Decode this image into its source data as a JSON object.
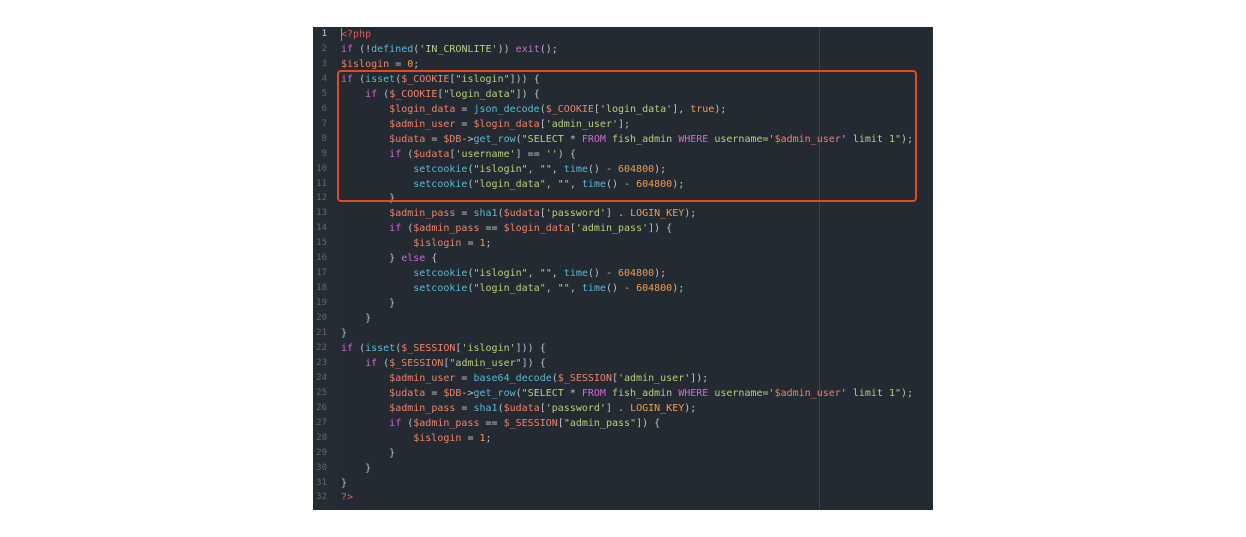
{
  "colors": {
    "keyword": "#cf6ad6",
    "variable": "#f0826a",
    "string": "#b9cf7a",
    "function": "#57b9d6",
    "number": "#ef9d4f",
    "php_tag": "#e05d5d",
    "plain": "#b8c2cc",
    "highlight_border": "#e8481f",
    "editor_bg": "#242a31"
  },
  "highlight": {
    "from_line": 4,
    "to_line": 12
  },
  "lines": [
    {
      "n": "1",
      "active": true,
      "tokens": [
        {
          "t": "tag",
          "v": "<?php"
        }
      ]
    },
    {
      "n": "2",
      "tokens": [
        {
          "t": "kw",
          "v": "if"
        },
        {
          "t": "plain",
          "v": " (!"
        },
        {
          "t": "fn",
          "v": "defined"
        },
        {
          "t": "plain",
          "v": "("
        },
        {
          "t": "str",
          "v": "'IN_CRONLITE'"
        },
        {
          "t": "plain",
          "v": ")) "
        },
        {
          "t": "kw",
          "v": "exit"
        },
        {
          "t": "plain",
          "v": "();"
        }
      ]
    },
    {
      "n": "3",
      "tokens": [
        {
          "t": "var",
          "v": "$islogin"
        },
        {
          "t": "plain",
          "v": " = "
        },
        {
          "t": "num",
          "v": "0"
        },
        {
          "t": "plain",
          "v": ";"
        }
      ]
    },
    {
      "n": "4",
      "tokens": [
        {
          "t": "kw",
          "v": "if"
        },
        {
          "t": "plain",
          "v": " ("
        },
        {
          "t": "fn",
          "v": "isset"
        },
        {
          "t": "plain",
          "v": "("
        },
        {
          "t": "var",
          "v": "$_COOKIE"
        },
        {
          "t": "plain",
          "v": "["
        },
        {
          "t": "str",
          "v": "\"islogin\""
        },
        {
          "t": "plain",
          "v": "])) {"
        }
      ]
    },
    {
      "n": "5",
      "tokens": [
        {
          "t": "plain",
          "v": "    "
        },
        {
          "t": "kw",
          "v": "if"
        },
        {
          "t": "plain",
          "v": " ("
        },
        {
          "t": "var",
          "v": "$_COOKIE"
        },
        {
          "t": "plain",
          "v": "["
        },
        {
          "t": "str",
          "v": "\"login_data\""
        },
        {
          "t": "plain",
          "v": "]) {"
        }
      ]
    },
    {
      "n": "6",
      "tokens": [
        {
          "t": "plain",
          "v": "        "
        },
        {
          "t": "var",
          "v": "$login_data"
        },
        {
          "t": "plain",
          "v": " = "
        },
        {
          "t": "fn",
          "v": "json_decode"
        },
        {
          "t": "plain",
          "v": "("
        },
        {
          "t": "var",
          "v": "$_COOKIE"
        },
        {
          "t": "plain",
          "v": "["
        },
        {
          "t": "str",
          "v": "'login_data'"
        },
        {
          "t": "plain",
          "v": "], "
        },
        {
          "t": "num",
          "v": "true"
        },
        {
          "t": "plain",
          "v": ");"
        }
      ]
    },
    {
      "n": "7",
      "tokens": [
        {
          "t": "plain",
          "v": "        "
        },
        {
          "t": "var",
          "v": "$admin_user"
        },
        {
          "t": "plain",
          "v": " = "
        },
        {
          "t": "var",
          "v": "$login_data"
        },
        {
          "t": "plain",
          "v": "["
        },
        {
          "t": "str",
          "v": "'admin_user'"
        },
        {
          "t": "plain",
          "v": "];"
        }
      ]
    },
    {
      "n": "8",
      "tokens": [
        {
          "t": "plain",
          "v": "        "
        },
        {
          "t": "var",
          "v": "$udata"
        },
        {
          "t": "plain",
          "v": " = "
        },
        {
          "t": "var",
          "v": "$DB"
        },
        {
          "t": "plain",
          "v": "->"
        },
        {
          "t": "fn",
          "v": "get_row"
        },
        {
          "t": "plain",
          "v": "("
        },
        {
          "t": "str",
          "v": "\"SELECT "
        },
        {
          "t": "plain",
          "v": "* "
        },
        {
          "t": "kw",
          "v": "FROM"
        },
        {
          "t": "str",
          "v": " fish_admin "
        },
        {
          "t": "kw",
          "v": "WHERE"
        },
        {
          "t": "str",
          "v": " username='"
        },
        {
          "t": "var",
          "v": "$admin_user"
        },
        {
          "t": "str",
          "v": "' limit 1\""
        },
        {
          "t": "plain",
          "v": ");"
        }
      ]
    },
    {
      "n": "9",
      "tokens": [
        {
          "t": "plain",
          "v": "        "
        },
        {
          "t": "kw",
          "v": "if"
        },
        {
          "t": "plain",
          "v": " ("
        },
        {
          "t": "var",
          "v": "$udata"
        },
        {
          "t": "plain",
          "v": "["
        },
        {
          "t": "str",
          "v": "'username'"
        },
        {
          "t": "plain",
          "v": "] == "
        },
        {
          "t": "str",
          "v": "''"
        },
        {
          "t": "plain",
          "v": ") {"
        }
      ]
    },
    {
      "n": "10",
      "tokens": [
        {
          "t": "plain",
          "v": "            "
        },
        {
          "t": "fn",
          "v": "setcookie"
        },
        {
          "t": "plain",
          "v": "("
        },
        {
          "t": "str",
          "v": "\"islogin\""
        },
        {
          "t": "plain",
          "v": ", "
        },
        {
          "t": "str",
          "v": "\"\""
        },
        {
          "t": "plain",
          "v": ", "
        },
        {
          "t": "fn",
          "v": "time"
        },
        {
          "t": "plain",
          "v": "() - "
        },
        {
          "t": "num",
          "v": "604800"
        },
        {
          "t": "plain",
          "v": ");"
        }
      ]
    },
    {
      "n": "11",
      "tokens": [
        {
          "t": "plain",
          "v": "            "
        },
        {
          "t": "fn",
          "v": "setcookie"
        },
        {
          "t": "plain",
          "v": "("
        },
        {
          "t": "str",
          "v": "\"login_data\""
        },
        {
          "t": "plain",
          "v": ", "
        },
        {
          "t": "str",
          "v": "\"\""
        },
        {
          "t": "plain",
          "v": ", "
        },
        {
          "t": "fn",
          "v": "time"
        },
        {
          "t": "plain",
          "v": "() - "
        },
        {
          "t": "num",
          "v": "604800"
        },
        {
          "t": "plain",
          "v": ");"
        }
      ]
    },
    {
      "n": "12",
      "tokens": [
        {
          "t": "plain",
          "v": "        }"
        }
      ]
    },
    {
      "n": "13",
      "tokens": [
        {
          "t": "plain",
          "v": "        "
        },
        {
          "t": "var",
          "v": "$admin_pass"
        },
        {
          "t": "plain",
          "v": " = "
        },
        {
          "t": "fn",
          "v": "sha1"
        },
        {
          "t": "plain",
          "v": "("
        },
        {
          "t": "var",
          "v": "$udata"
        },
        {
          "t": "plain",
          "v": "["
        },
        {
          "t": "str",
          "v": "'password'"
        },
        {
          "t": "plain",
          "v": "] . "
        },
        {
          "t": "num",
          "v": "LOGIN_KEY"
        },
        {
          "t": "plain",
          "v": ");"
        }
      ]
    },
    {
      "n": "14",
      "tokens": [
        {
          "t": "plain",
          "v": "        "
        },
        {
          "t": "kw",
          "v": "if"
        },
        {
          "t": "plain",
          "v": " ("
        },
        {
          "t": "var",
          "v": "$admin_pass"
        },
        {
          "t": "plain",
          "v": " == "
        },
        {
          "t": "var",
          "v": "$login_data"
        },
        {
          "t": "plain",
          "v": "["
        },
        {
          "t": "str",
          "v": "'admin_pass'"
        },
        {
          "t": "plain",
          "v": "]) {"
        }
      ]
    },
    {
      "n": "15",
      "tokens": [
        {
          "t": "plain",
          "v": "            "
        },
        {
          "t": "var",
          "v": "$islogin"
        },
        {
          "t": "plain",
          "v": " = "
        },
        {
          "t": "num",
          "v": "1"
        },
        {
          "t": "plain",
          "v": ";"
        }
      ]
    },
    {
      "n": "16",
      "tokens": [
        {
          "t": "plain",
          "v": "        } "
        },
        {
          "t": "kw",
          "v": "else"
        },
        {
          "t": "plain",
          "v": " {"
        }
      ]
    },
    {
      "n": "17",
      "tokens": [
        {
          "t": "plain",
          "v": "            "
        },
        {
          "t": "fn",
          "v": "setcookie"
        },
        {
          "t": "plain",
          "v": "("
        },
        {
          "t": "str",
          "v": "\"islogin\""
        },
        {
          "t": "plain",
          "v": ", "
        },
        {
          "t": "str",
          "v": "\"\""
        },
        {
          "t": "plain",
          "v": ", "
        },
        {
          "t": "fn",
          "v": "time"
        },
        {
          "t": "plain",
          "v": "() - "
        },
        {
          "t": "num",
          "v": "604800"
        },
        {
          "t": "plain",
          "v": ");"
        }
      ]
    },
    {
      "n": "18",
      "tokens": [
        {
          "t": "plain",
          "v": "            "
        },
        {
          "t": "fn",
          "v": "setcookie"
        },
        {
          "t": "plain",
          "v": "("
        },
        {
          "t": "str",
          "v": "\"login_data\""
        },
        {
          "t": "plain",
          "v": ", "
        },
        {
          "t": "str",
          "v": "\"\""
        },
        {
          "t": "plain",
          "v": ", "
        },
        {
          "t": "fn",
          "v": "time"
        },
        {
          "t": "plain",
          "v": "() - "
        },
        {
          "t": "num",
          "v": "604800"
        },
        {
          "t": "plain",
          "v": ");"
        }
      ]
    },
    {
      "n": "19",
      "tokens": [
        {
          "t": "plain",
          "v": "        }"
        }
      ]
    },
    {
      "n": "20",
      "tokens": [
        {
          "t": "plain",
          "v": "    }"
        }
      ]
    },
    {
      "n": "21",
      "tokens": [
        {
          "t": "plain",
          "v": "}"
        }
      ]
    },
    {
      "n": "22",
      "tokens": [
        {
          "t": "kw",
          "v": "if"
        },
        {
          "t": "plain",
          "v": " ("
        },
        {
          "t": "fn",
          "v": "isset"
        },
        {
          "t": "plain",
          "v": "("
        },
        {
          "t": "var",
          "v": "$_SESSION"
        },
        {
          "t": "plain",
          "v": "["
        },
        {
          "t": "str",
          "v": "'islogin'"
        },
        {
          "t": "plain",
          "v": "])) {"
        }
      ]
    },
    {
      "n": "23",
      "tokens": [
        {
          "t": "plain",
          "v": "    "
        },
        {
          "t": "kw",
          "v": "if"
        },
        {
          "t": "plain",
          "v": " ("
        },
        {
          "t": "var",
          "v": "$_SESSION"
        },
        {
          "t": "plain",
          "v": "["
        },
        {
          "t": "str",
          "v": "\"admin_user\""
        },
        {
          "t": "plain",
          "v": "]) {"
        }
      ]
    },
    {
      "n": "24",
      "tokens": [
        {
          "t": "plain",
          "v": "        "
        },
        {
          "t": "var",
          "v": "$admin_user"
        },
        {
          "t": "plain",
          "v": " = "
        },
        {
          "t": "fn",
          "v": "base64_decode"
        },
        {
          "t": "plain",
          "v": "("
        },
        {
          "t": "var",
          "v": "$_SESSION"
        },
        {
          "t": "plain",
          "v": "["
        },
        {
          "t": "str",
          "v": "'admin_user'"
        },
        {
          "t": "plain",
          "v": "]);"
        }
      ]
    },
    {
      "n": "25",
      "tokens": [
        {
          "t": "plain",
          "v": "        "
        },
        {
          "t": "var",
          "v": "$udata"
        },
        {
          "t": "plain",
          "v": " = "
        },
        {
          "t": "var",
          "v": "$DB"
        },
        {
          "t": "plain",
          "v": "->"
        },
        {
          "t": "fn",
          "v": "get_row"
        },
        {
          "t": "plain",
          "v": "("
        },
        {
          "t": "str",
          "v": "\"SELECT "
        },
        {
          "t": "plain",
          "v": "* "
        },
        {
          "t": "kw",
          "v": "FROM"
        },
        {
          "t": "str",
          "v": " fish_admin "
        },
        {
          "t": "kw",
          "v": "WHERE"
        },
        {
          "t": "str",
          "v": " username='"
        },
        {
          "t": "var",
          "v": "$admin_user"
        },
        {
          "t": "str",
          "v": "' limit 1\""
        },
        {
          "t": "plain",
          "v": ");"
        }
      ]
    },
    {
      "n": "26",
      "tokens": [
        {
          "t": "plain",
          "v": "        "
        },
        {
          "t": "var",
          "v": "$admin_pass"
        },
        {
          "t": "plain",
          "v": " = "
        },
        {
          "t": "fn",
          "v": "sha1"
        },
        {
          "t": "plain",
          "v": "("
        },
        {
          "t": "var",
          "v": "$udata"
        },
        {
          "t": "plain",
          "v": "["
        },
        {
          "t": "str",
          "v": "'password'"
        },
        {
          "t": "plain",
          "v": "] . "
        },
        {
          "t": "num",
          "v": "LOGIN_KEY"
        },
        {
          "t": "plain",
          "v": ");"
        }
      ]
    },
    {
      "n": "27",
      "tokens": [
        {
          "t": "plain",
          "v": "        "
        },
        {
          "t": "kw",
          "v": "if"
        },
        {
          "t": "plain",
          "v": " ("
        },
        {
          "t": "var",
          "v": "$admin_pass"
        },
        {
          "t": "plain",
          "v": " == "
        },
        {
          "t": "var",
          "v": "$_SESSION"
        },
        {
          "t": "plain",
          "v": "["
        },
        {
          "t": "str",
          "v": "\"admin_pass\""
        },
        {
          "t": "plain",
          "v": "]) {"
        }
      ]
    },
    {
      "n": "28",
      "tokens": [
        {
          "t": "plain",
          "v": "            "
        },
        {
          "t": "var",
          "v": "$islogin"
        },
        {
          "t": "plain",
          "v": " = "
        },
        {
          "t": "num",
          "v": "1"
        },
        {
          "t": "plain",
          "v": ";"
        }
      ]
    },
    {
      "n": "29",
      "tokens": [
        {
          "t": "plain",
          "v": "        }"
        }
      ]
    },
    {
      "n": "30",
      "tokens": [
        {
          "t": "plain",
          "v": "    }"
        }
      ]
    },
    {
      "n": "31",
      "tokens": [
        {
          "t": "plain",
          "v": "}"
        }
      ]
    },
    {
      "n": "32",
      "tokens": [
        {
          "t": "tag",
          "v": "?>"
        }
      ]
    }
  ]
}
